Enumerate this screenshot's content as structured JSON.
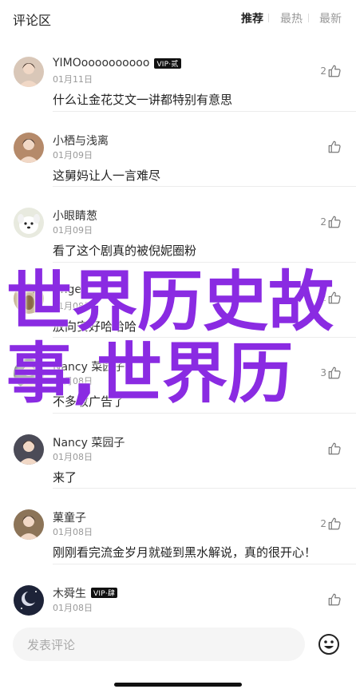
{
  "header": {
    "title": "评论区",
    "tabs": [
      {
        "label": "推荐",
        "active": true
      },
      {
        "label": "最热",
        "active": false
      },
      {
        "label": "最新",
        "active": false
      }
    ]
  },
  "comments": [
    {
      "name": "YIMOoooooooooo",
      "vip": "VIP·贰",
      "date": "01月11日",
      "text": "什么让金花艾文一讲都特别有意思",
      "likes": "2",
      "avatar_color": "#d9c7b8",
      "avatar_icon": "person-avatar"
    },
    {
      "name": "小栖与浅离",
      "vip": "",
      "date": "01月09日",
      "text": "这舅妈让人一言难尽",
      "likes": "",
      "avatar_color": "#b58a6a",
      "avatar_icon": "person-avatar"
    },
    {
      "name": "小眼睛葱",
      "vip": "",
      "date": "01月09日",
      "text": "看了这个剧真的被倪妮圈粉",
      "likes": "2",
      "avatar_color": "#e8eadf",
      "avatar_icon": "dog-avatar"
    },
    {
      "name": "Angel",
      "vip": "",
      "date": "01月08日",
      "text": "放向安好哈哈哈",
      "likes": "2",
      "avatar_color": "#c9b89a",
      "avatar_icon": "deer-avatar"
    },
    {
      "name": "Nancy 菜园子",
      "vip": "",
      "date": "01月08日",
      "text": "不多收广告了",
      "likes": "3",
      "avatar_color": "#5a6b5a",
      "avatar_icon": "person-avatar"
    },
    {
      "name": "Nancy 菜园子",
      "vip": "",
      "date": "01月08日",
      "text": "来了",
      "likes": "",
      "avatar_color": "#4b4b57",
      "avatar_icon": "person-avatar"
    },
    {
      "name": "菓童子",
      "vip": "",
      "date": "01月08日",
      "text": "刚刚看完流金岁月就碰到黑水解说，真的很开心！",
      "likes": "2",
      "avatar_color": "#8c7458",
      "avatar_icon": "person-avatar"
    },
    {
      "name": "木舜生",
      "vip": "VIP·肆",
      "date": "01月08日",
      "text": "",
      "likes": "",
      "avatar_color": "#1d2338",
      "avatar_icon": "moon-avatar"
    }
  ],
  "overlay": {
    "line1": "世界历史故",
    "line2": "事,世界历",
    "color": "#8a2be2"
  },
  "bottom": {
    "input_placeholder": "发表评论",
    "emoji_icon": "smiley-icon"
  }
}
